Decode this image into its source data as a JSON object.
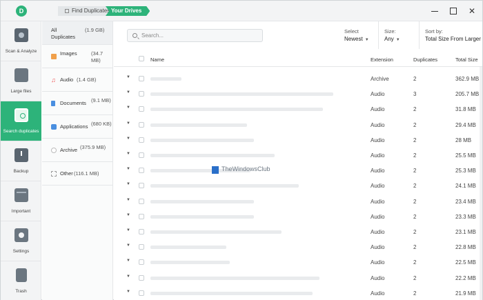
{
  "titlebar": {
    "logo_text": "D",
    "breadcrumb": [
      "Find Duplicates",
      "Your Drives"
    ]
  },
  "sidebar": {
    "items": [
      {
        "label": "Scan & Analyze",
        "icon": "scan-icon"
      },
      {
        "label": "Large files",
        "icon": "large-files-icon"
      },
      {
        "label": "Search duplicates",
        "icon": "search-duplicates-icon",
        "active": true
      },
      {
        "label": "Backup",
        "icon": "backup-icon"
      },
      {
        "label": "Important",
        "icon": "important-icon"
      },
      {
        "label": "Settings",
        "icon": "settings-icon"
      },
      {
        "label": "Trash",
        "icon": "trash-icon"
      }
    ]
  },
  "categories": [
    {
      "name": "All Duplicates",
      "size": "(1.9 GB)"
    },
    {
      "name": "Images",
      "size": "(34.7 MB)"
    },
    {
      "name": "Audio",
      "size": "(1.4 GB)"
    },
    {
      "name": "Documents",
      "size": "(9.1 MB)"
    },
    {
      "name": "Applications",
      "size": "(680 KB)"
    },
    {
      "name": "Archive",
      "size": "(375.9 MB)"
    },
    {
      "name": "Other",
      "size": "(116.1 MB)"
    }
  ],
  "toolbar": {
    "search_placeholder": "Search...",
    "select_label": "Select",
    "select_value": "Newest",
    "size_label": "Size:",
    "size_value": "Any",
    "sort_label": "Sort by:",
    "sort_value": "Total Size From Larger"
  },
  "table": {
    "headers": {
      "name": "Name",
      "extension": "Extension",
      "duplicates": "Duplicates",
      "total_size": "Total Size"
    },
    "rows": [
      {
        "extension": "Archive",
        "duplicates": "2",
        "total_size": "362.9 MB",
        "name_bar": 45
      },
      {
        "extension": "Audio",
        "duplicates": "3",
        "total_size": "205.7 MB",
        "name_bar": 265
      },
      {
        "extension": "Audio",
        "duplicates": "2",
        "total_size": "31.8 MB",
        "name_bar": 250
      },
      {
        "extension": "Audio",
        "duplicates": "2",
        "total_size": "29.4 MB",
        "name_bar": 140
      },
      {
        "extension": "Audio",
        "duplicates": "2",
        "total_size": "28 MB",
        "name_bar": 150
      },
      {
        "extension": "Audio",
        "duplicates": "2",
        "total_size": "25.5 MB",
        "name_bar": 180
      },
      {
        "extension": "Audio",
        "duplicates": "2",
        "total_size": "25.3 MB",
        "name_bar": 145
      },
      {
        "extension": "Audio",
        "duplicates": "2",
        "total_size": "24.1 MB",
        "name_bar": 215
      },
      {
        "extension": "Audio",
        "duplicates": "2",
        "total_size": "23.4 MB",
        "name_bar": 150
      },
      {
        "extension": "Audio",
        "duplicates": "2",
        "total_size": "23.3 MB",
        "name_bar": 150
      },
      {
        "extension": "Audio",
        "duplicates": "2",
        "total_size": "23.1 MB",
        "name_bar": 190
      },
      {
        "extension": "Audio",
        "duplicates": "2",
        "total_size": "22.8 MB",
        "name_bar": 110
      },
      {
        "extension": "Audio",
        "duplicates": "2",
        "total_size": "22.5 MB",
        "name_bar": 115
      },
      {
        "extension": "Audio",
        "duplicates": "2",
        "total_size": "22.2 MB",
        "name_bar": 245
      },
      {
        "extension": "Audio",
        "duplicates": "2",
        "total_size": "21.9 MB",
        "name_bar": 235
      }
    ]
  },
  "watermark": "TheWindowsClub",
  "colors": {
    "accent": "#2db37a",
    "sidebar_bg": "#f3f4f5"
  }
}
